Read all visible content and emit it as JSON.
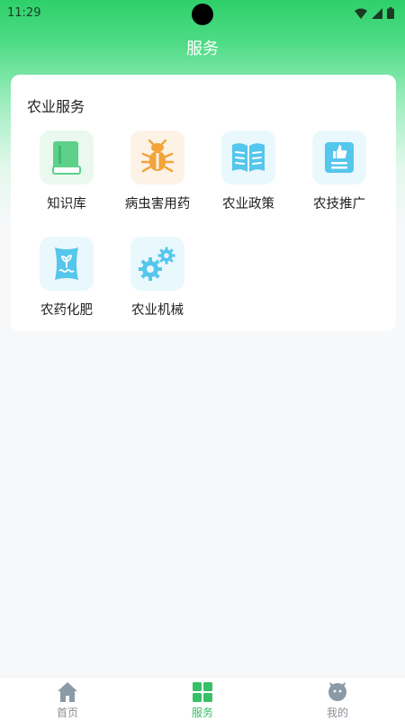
{
  "status_bar": {
    "time": "11:29"
  },
  "header": {
    "title": "服务"
  },
  "card": {
    "title": "农业服务",
    "items": [
      {
        "label": "知识库",
        "icon": "book-icon"
      },
      {
        "label": "病虫害用药",
        "icon": "bug-icon"
      },
      {
        "label": "农业政策",
        "icon": "open-book-icon"
      },
      {
        "label": "农技推广",
        "icon": "thumbs-up-document-icon"
      },
      {
        "label": "农药化肥",
        "icon": "fertilizer-bag-icon"
      },
      {
        "label": "农业机械",
        "icon": "gears-icon"
      }
    ]
  },
  "bottom_nav": {
    "items": [
      {
        "label": "首页",
        "icon": "home-icon"
      },
      {
        "label": "服务",
        "icon": "grid-icon",
        "active": true
      },
      {
        "label": "我的",
        "icon": "profile-face-icon"
      }
    ]
  },
  "colors": {
    "accent": "#37c066",
    "book": "#5dd08a",
    "bug": "#f3a43a",
    "blue_icons": "#55c6ec"
  }
}
